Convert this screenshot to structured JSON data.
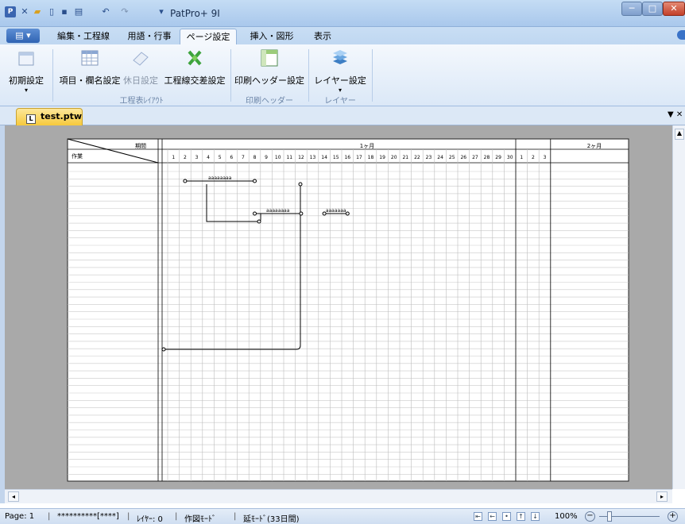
{
  "app": {
    "title": "PatPro+ 9I"
  },
  "quick_access": [
    "save-icon",
    "open-icon",
    "new-icon",
    "print-icon",
    "undo-icon",
    "redo-icon"
  ],
  "menu_tabs": [
    "編集・工程線",
    "用語・行事",
    "ページ設定",
    "挿入・図形",
    "表示"
  ],
  "active_tab": "ページ設定",
  "ribbon": {
    "buttons": [
      "初期設定",
      "項目・欄名設定",
      "休日設定",
      "工程線交差設定",
      "印刷ヘッダー設定",
      "レイヤー設定"
    ],
    "groups": [
      "工程表ﾚｲｱｳﾄ",
      "印刷ヘッダー",
      "レイヤー"
    ]
  },
  "document_tab": "test.ptw",
  "sheet": {
    "corner_top": "期間",
    "corner_bottom": "作業",
    "month1": "1ヶ月",
    "month2": "2ヶ月",
    "days": [
      "1",
      "2",
      "3",
      "4",
      "5",
      "6",
      "7",
      "8",
      "9",
      "10",
      "11",
      "12",
      "13",
      "14",
      "15",
      "16",
      "17",
      "18",
      "19",
      "20",
      "21",
      "22",
      "23",
      "24",
      "25",
      "26",
      "27",
      "28",
      "29",
      "30",
      "1",
      "2",
      "3"
    ],
    "bars": [
      {
        "label": "aaaaaaaa",
        "from_day": 2,
        "to_day": 8
      },
      {
        "label": "aaaaaaaa",
        "from_day": 8,
        "to_day": 12
      },
      {
        "label": "aaaaaaa",
        "from_day": 14,
        "to_day": 16
      }
    ]
  },
  "status": {
    "page": "Page: 1",
    "mask": "**********[****]",
    "layer": "ﾚｲﾔｰ: 0",
    "mode": "作図ﾓｰﾄﾞ",
    "extend": "延ﾓｰﾄﾞ(33日間)",
    "zoom": "100%"
  },
  "colors": {
    "titlebar": "#a9c8ec",
    "ribbon": "#dbe8f7",
    "workspace": "#a9a9a9",
    "doc_tab": "#f6c93c"
  }
}
